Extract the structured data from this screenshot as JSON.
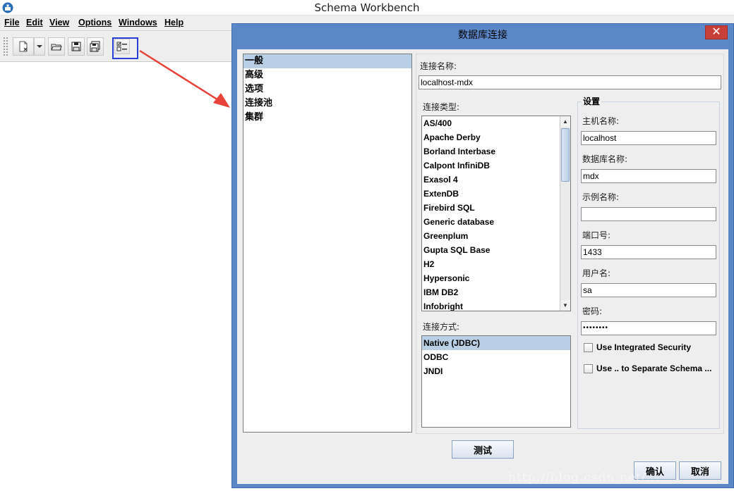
{
  "window": {
    "title": "Schema Workbench"
  },
  "menu": [
    {
      "label": "File"
    },
    {
      "label": "Edit"
    },
    {
      "label": "View"
    },
    {
      "label": "Options"
    },
    {
      "label": "Windows"
    },
    {
      "label": "Help"
    }
  ],
  "toolbar": {
    "buttons": [
      "new-schema-icon",
      "dropdown-arrow-icon",
      "open-folder-icon",
      "save-icon",
      "save-as-icon",
      "connection-icon"
    ]
  },
  "dialog": {
    "title": "数据库连接",
    "close_glyph": "✕",
    "nav": [
      "一般",
      "高级",
      "选项",
      "连接池",
      "集群"
    ],
    "nav_selected": 0,
    "connection_name_label": "连接名称:",
    "connection_name_value": "localhost-mdx",
    "connection_type_label": "连接类型:",
    "connection_types": [
      "AS/400",
      "Apache Derby",
      "Borland Interbase",
      "Calpont InfiniDB",
      "Exasol 4",
      "ExtenDB",
      "Firebird SQL",
      "Generic database",
      "Greenplum",
      "Gupta SQL Base",
      "H2",
      "Hypersonic",
      "IBM DB2",
      "Infobright"
    ],
    "access_label": "连接方式:",
    "access_methods": [
      "Native (JDBC)",
      "ODBC",
      "JNDI"
    ],
    "access_selected": 0,
    "settings": {
      "title": "设置",
      "host_label": "主机名称:",
      "host_value": "localhost",
      "db_label": "数据库名称:",
      "db_value": "mdx",
      "instance_label": "示例名称:",
      "instance_value": "",
      "port_label": "端口号:",
      "port_value": "1433",
      "user_label": "用户名:",
      "user_value": "sa",
      "password_label": "密码:",
      "password_value": "••••••••",
      "integrated_security_label": "Use Integrated Security",
      "separate_schema_label": "Use .. to Separate Schema ..."
    },
    "test_button": "测试",
    "ok_button": "确认",
    "cancel_button": "取消"
  },
  "watermark": "http://blog.csdn.net/..."
}
